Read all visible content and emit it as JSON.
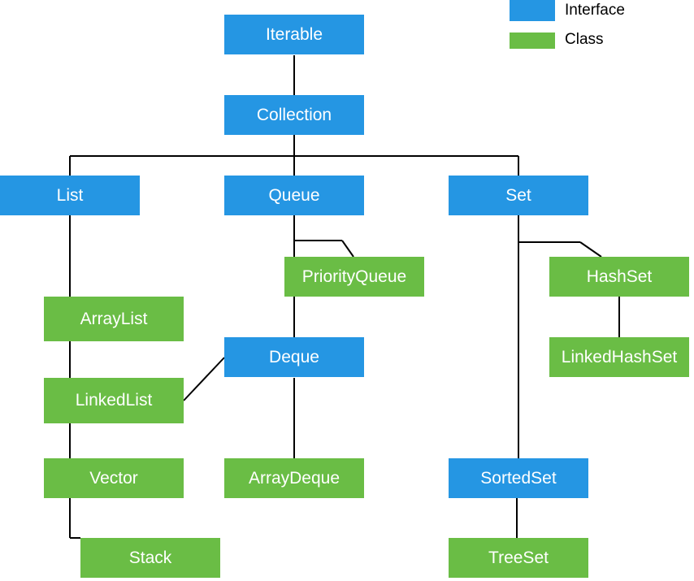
{
  "legend": {
    "interface_label": "Interface",
    "class_label": "Class"
  },
  "colors": {
    "interface": "#2596E3",
    "class": "#6ABD45"
  },
  "nodes": {
    "iterable": "Iterable",
    "collection": "Collection",
    "list": "List",
    "queue": "Queue",
    "set": "Set",
    "arraylist": "ArrayList",
    "linkedlist": "LinkedList",
    "vector": "Vector",
    "stack": "Stack",
    "priorityqueue": "PriorityQueue",
    "deque": "Deque",
    "arraydeque": "ArrayDeque",
    "hashset": "HashSet",
    "linkedhashset": "LinkedHashSet",
    "sortedset": "SortedSet",
    "treeset": "TreeSet"
  }
}
